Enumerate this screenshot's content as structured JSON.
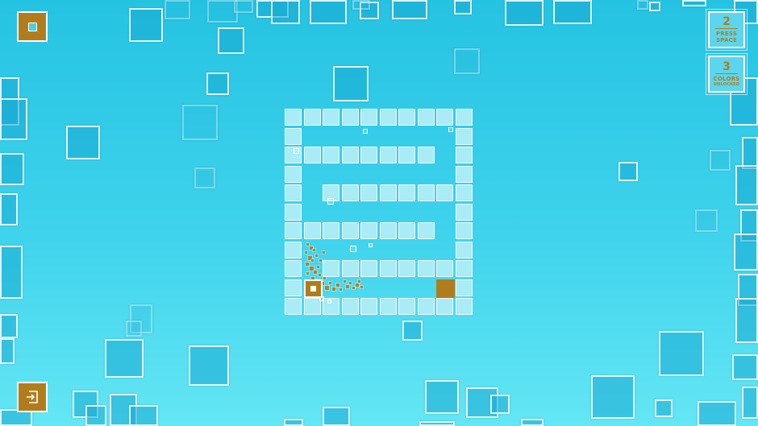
{
  "hud": {
    "menu_icon": "square-dot-icon",
    "exit_icon": "exit-door-icon",
    "hints": [
      {
        "number": "2",
        "line1": "PRESS",
        "line2": "SPACE"
      },
      {
        "number": "3",
        "line1": "COLORS",
        "line2": "UNLOCKED"
      }
    ]
  },
  "level": {
    "player_icon": "player-square-icon",
    "goal_icon": "goal-square-icon"
  },
  "colors": {
    "background_top": "#25c3e2",
    "background_bottom": "#64e6f4",
    "tile": "#a9ecf6",
    "player": "#b17d1c",
    "goal": "#b17d1c",
    "accent": "#ffffff"
  }
}
